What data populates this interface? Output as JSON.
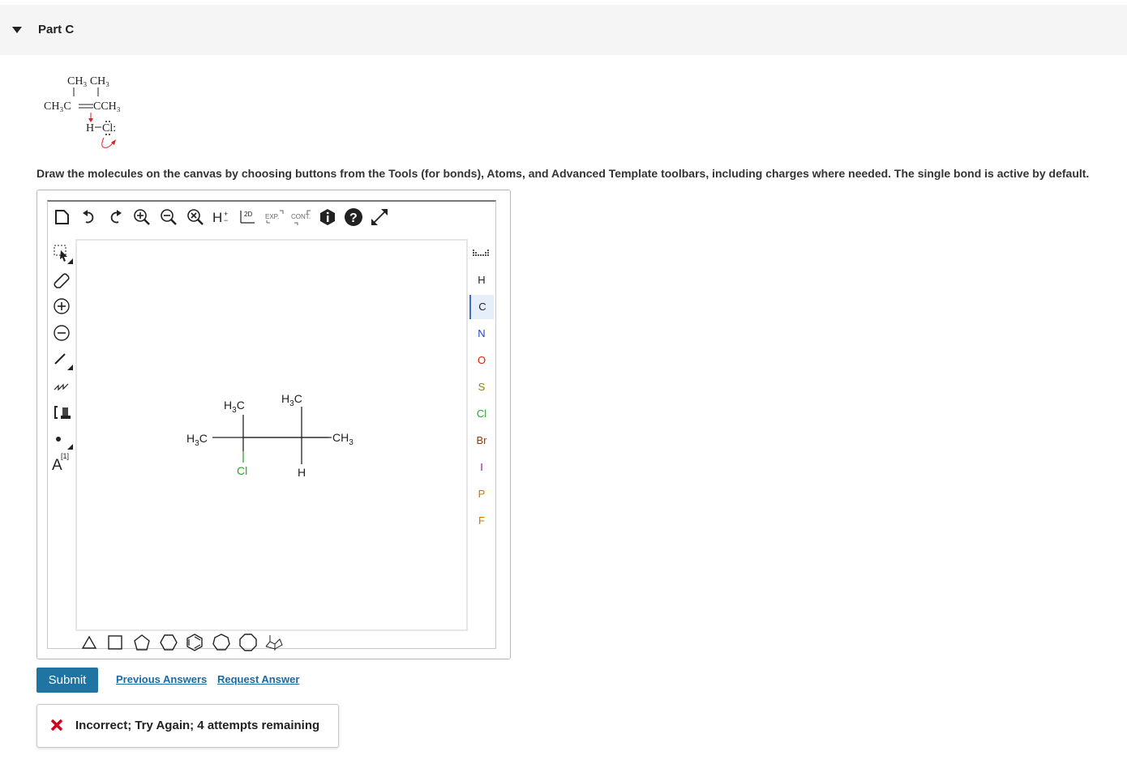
{
  "part": {
    "title": "Part C"
  },
  "question": {
    "line1": "CH₃ CH₃",
    "line2_left": "CH₃C",
    "line2_right": "CCH₃",
    "line3_h": "H",
    "line3_cl": "Cl:"
  },
  "instructions": "Draw the molecules on the canvas by choosing buttons from the Tools (for bonds), Atoms, and Advanced Template toolbars, including charges where needed. The single bond is active by default.",
  "toolbar": {
    "exp_label": "EXP.",
    "cont_label": "CONT.",
    "h_label": "H",
    "twod_label": "2D",
    "mapping_label": "[1]",
    "atom_label": "A"
  },
  "atoms": [
    "H",
    "C",
    "N",
    "O",
    "S",
    "Cl",
    "Br",
    "I",
    "P",
    "F"
  ],
  "atom_colors": {
    "H": "#222222",
    "C": "#222222",
    "N": "#2244cc",
    "O": "#dd2200",
    "S": "#888800",
    "Cl": "#22aa22",
    "Br": "#aa3300",
    "I": "#882288",
    "P": "#cc7700",
    "F": "#cc7700"
  },
  "active_atom": "C",
  "molecule": {
    "left_methyl": "H",
    "left_methyl_sub": "3",
    "left_methyl_c": "C",
    "top_methyl1_h": "H",
    "top_methyl1_sub": "3",
    "top_methyl1_c": "C",
    "top_methyl2_h": "H",
    "top_methyl2_sub": "3",
    "top_methyl2_c": "C",
    "right_methyl_ch": "CH",
    "right_methyl_sub": "3",
    "chlorine": "Cl",
    "hydrogen": "H"
  },
  "actions": {
    "submit": "Submit",
    "previous_answers": "Previous Answers",
    "request_answer": "Request Answer"
  },
  "feedback": {
    "text": "Incorrect; Try Again; 4 attempts remaining",
    "icon_color": "#d0021b"
  },
  "colors": {
    "submit_bg": "#1f74a1",
    "link": "#1a6aa3",
    "chlorine": "#22aa22"
  }
}
